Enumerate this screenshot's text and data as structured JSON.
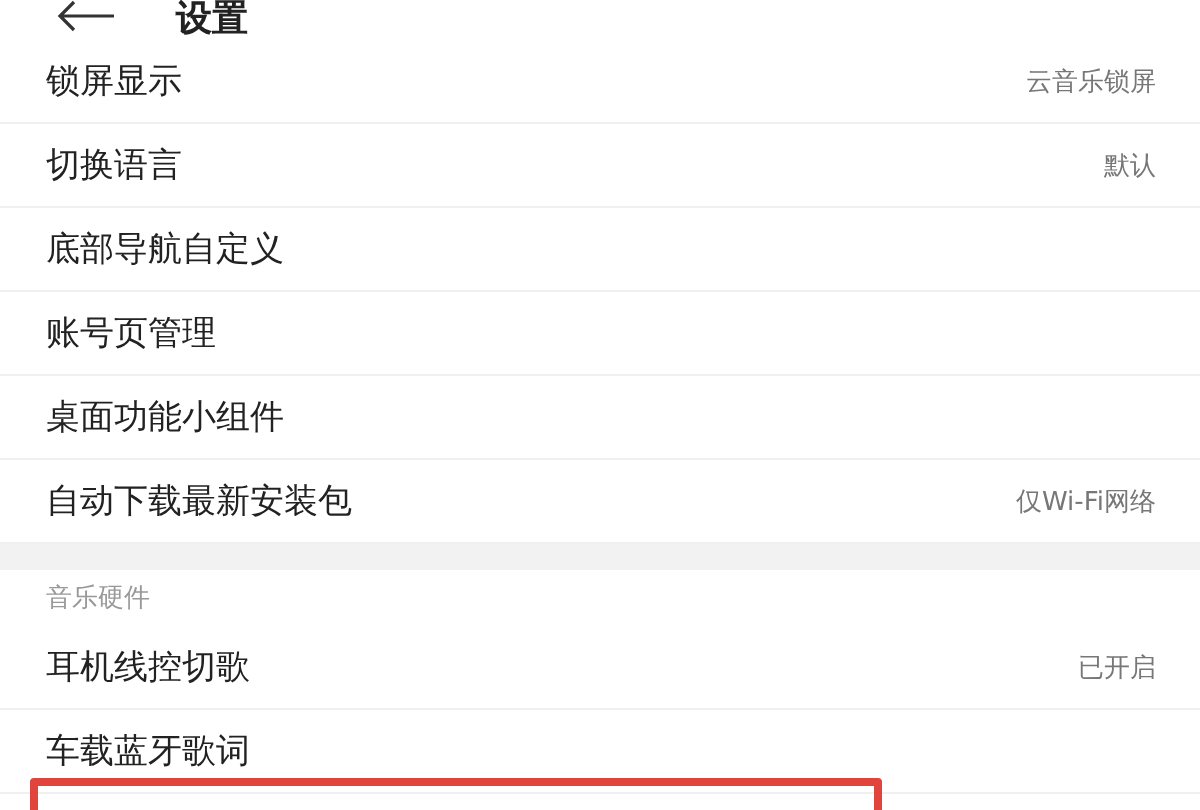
{
  "header": {
    "title": "设置"
  },
  "groups": [
    {
      "rows": [
        {
          "label": "锁屏显示",
          "value": "云音乐锁屏"
        },
        {
          "label": "切换语言",
          "value": "默认"
        },
        {
          "label": "底部导航自定义"
        },
        {
          "label": "账号页管理"
        },
        {
          "label": "桌面功能小组件"
        },
        {
          "label": "自动下载最新安装包",
          "value": "仅Wi-Fi网络"
        }
      ]
    },
    {
      "title": "音乐硬件",
      "rows": [
        {
          "label": "耳机线控切歌",
          "value": "已开启"
        },
        {
          "label": "车载蓝牙歌词"
        }
      ]
    }
  ]
}
